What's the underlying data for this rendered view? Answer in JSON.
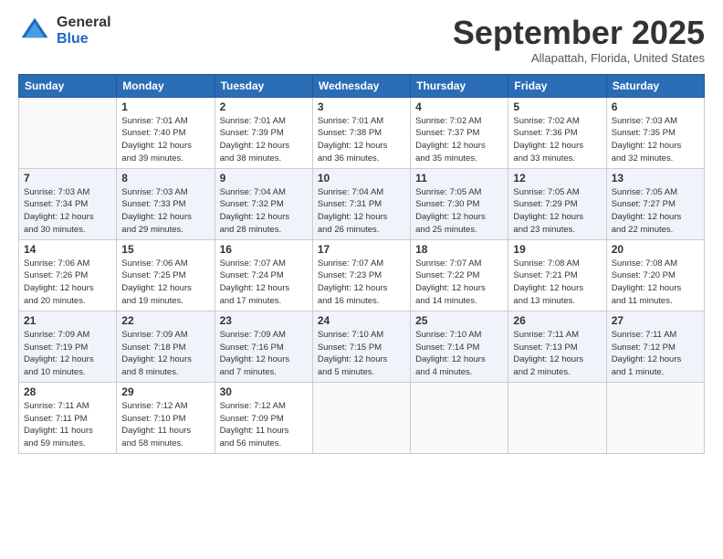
{
  "header": {
    "logo_general": "General",
    "logo_blue": "Blue",
    "month_title": "September 2025",
    "subtitle": "Allapattah, Florida, United States"
  },
  "days_of_week": [
    "Sunday",
    "Monday",
    "Tuesday",
    "Wednesday",
    "Thursday",
    "Friday",
    "Saturday"
  ],
  "weeks": [
    [
      {
        "day": "",
        "info": ""
      },
      {
        "day": "1",
        "info": "Sunrise: 7:01 AM\nSunset: 7:40 PM\nDaylight: 12 hours\nand 39 minutes."
      },
      {
        "day": "2",
        "info": "Sunrise: 7:01 AM\nSunset: 7:39 PM\nDaylight: 12 hours\nand 38 minutes."
      },
      {
        "day": "3",
        "info": "Sunrise: 7:01 AM\nSunset: 7:38 PM\nDaylight: 12 hours\nand 36 minutes."
      },
      {
        "day": "4",
        "info": "Sunrise: 7:02 AM\nSunset: 7:37 PM\nDaylight: 12 hours\nand 35 minutes."
      },
      {
        "day": "5",
        "info": "Sunrise: 7:02 AM\nSunset: 7:36 PM\nDaylight: 12 hours\nand 33 minutes."
      },
      {
        "day": "6",
        "info": "Sunrise: 7:03 AM\nSunset: 7:35 PM\nDaylight: 12 hours\nand 32 minutes."
      }
    ],
    [
      {
        "day": "7",
        "info": "Sunrise: 7:03 AM\nSunset: 7:34 PM\nDaylight: 12 hours\nand 30 minutes."
      },
      {
        "day": "8",
        "info": "Sunrise: 7:03 AM\nSunset: 7:33 PM\nDaylight: 12 hours\nand 29 minutes."
      },
      {
        "day": "9",
        "info": "Sunrise: 7:04 AM\nSunset: 7:32 PM\nDaylight: 12 hours\nand 28 minutes."
      },
      {
        "day": "10",
        "info": "Sunrise: 7:04 AM\nSunset: 7:31 PM\nDaylight: 12 hours\nand 26 minutes."
      },
      {
        "day": "11",
        "info": "Sunrise: 7:05 AM\nSunset: 7:30 PM\nDaylight: 12 hours\nand 25 minutes."
      },
      {
        "day": "12",
        "info": "Sunrise: 7:05 AM\nSunset: 7:29 PM\nDaylight: 12 hours\nand 23 minutes."
      },
      {
        "day": "13",
        "info": "Sunrise: 7:05 AM\nSunset: 7:27 PM\nDaylight: 12 hours\nand 22 minutes."
      }
    ],
    [
      {
        "day": "14",
        "info": "Sunrise: 7:06 AM\nSunset: 7:26 PM\nDaylight: 12 hours\nand 20 minutes."
      },
      {
        "day": "15",
        "info": "Sunrise: 7:06 AM\nSunset: 7:25 PM\nDaylight: 12 hours\nand 19 minutes."
      },
      {
        "day": "16",
        "info": "Sunrise: 7:07 AM\nSunset: 7:24 PM\nDaylight: 12 hours\nand 17 minutes."
      },
      {
        "day": "17",
        "info": "Sunrise: 7:07 AM\nSunset: 7:23 PM\nDaylight: 12 hours\nand 16 minutes."
      },
      {
        "day": "18",
        "info": "Sunrise: 7:07 AM\nSunset: 7:22 PM\nDaylight: 12 hours\nand 14 minutes."
      },
      {
        "day": "19",
        "info": "Sunrise: 7:08 AM\nSunset: 7:21 PM\nDaylight: 12 hours\nand 13 minutes."
      },
      {
        "day": "20",
        "info": "Sunrise: 7:08 AM\nSunset: 7:20 PM\nDaylight: 12 hours\nand 11 minutes."
      }
    ],
    [
      {
        "day": "21",
        "info": "Sunrise: 7:09 AM\nSunset: 7:19 PM\nDaylight: 12 hours\nand 10 minutes."
      },
      {
        "day": "22",
        "info": "Sunrise: 7:09 AM\nSunset: 7:18 PM\nDaylight: 12 hours\nand 8 minutes."
      },
      {
        "day": "23",
        "info": "Sunrise: 7:09 AM\nSunset: 7:16 PM\nDaylight: 12 hours\nand 7 minutes."
      },
      {
        "day": "24",
        "info": "Sunrise: 7:10 AM\nSunset: 7:15 PM\nDaylight: 12 hours\nand 5 minutes."
      },
      {
        "day": "25",
        "info": "Sunrise: 7:10 AM\nSunset: 7:14 PM\nDaylight: 12 hours\nand 4 minutes."
      },
      {
        "day": "26",
        "info": "Sunrise: 7:11 AM\nSunset: 7:13 PM\nDaylight: 12 hours\nand 2 minutes."
      },
      {
        "day": "27",
        "info": "Sunrise: 7:11 AM\nSunset: 7:12 PM\nDaylight: 12 hours\nand 1 minute."
      }
    ],
    [
      {
        "day": "28",
        "info": "Sunrise: 7:11 AM\nSunset: 7:11 PM\nDaylight: 11 hours\nand 59 minutes."
      },
      {
        "day": "29",
        "info": "Sunrise: 7:12 AM\nSunset: 7:10 PM\nDaylight: 11 hours\nand 58 minutes."
      },
      {
        "day": "30",
        "info": "Sunrise: 7:12 AM\nSunset: 7:09 PM\nDaylight: 11 hours\nand 56 minutes."
      },
      {
        "day": "",
        "info": ""
      },
      {
        "day": "",
        "info": ""
      },
      {
        "day": "",
        "info": ""
      },
      {
        "day": "",
        "info": ""
      }
    ]
  ]
}
